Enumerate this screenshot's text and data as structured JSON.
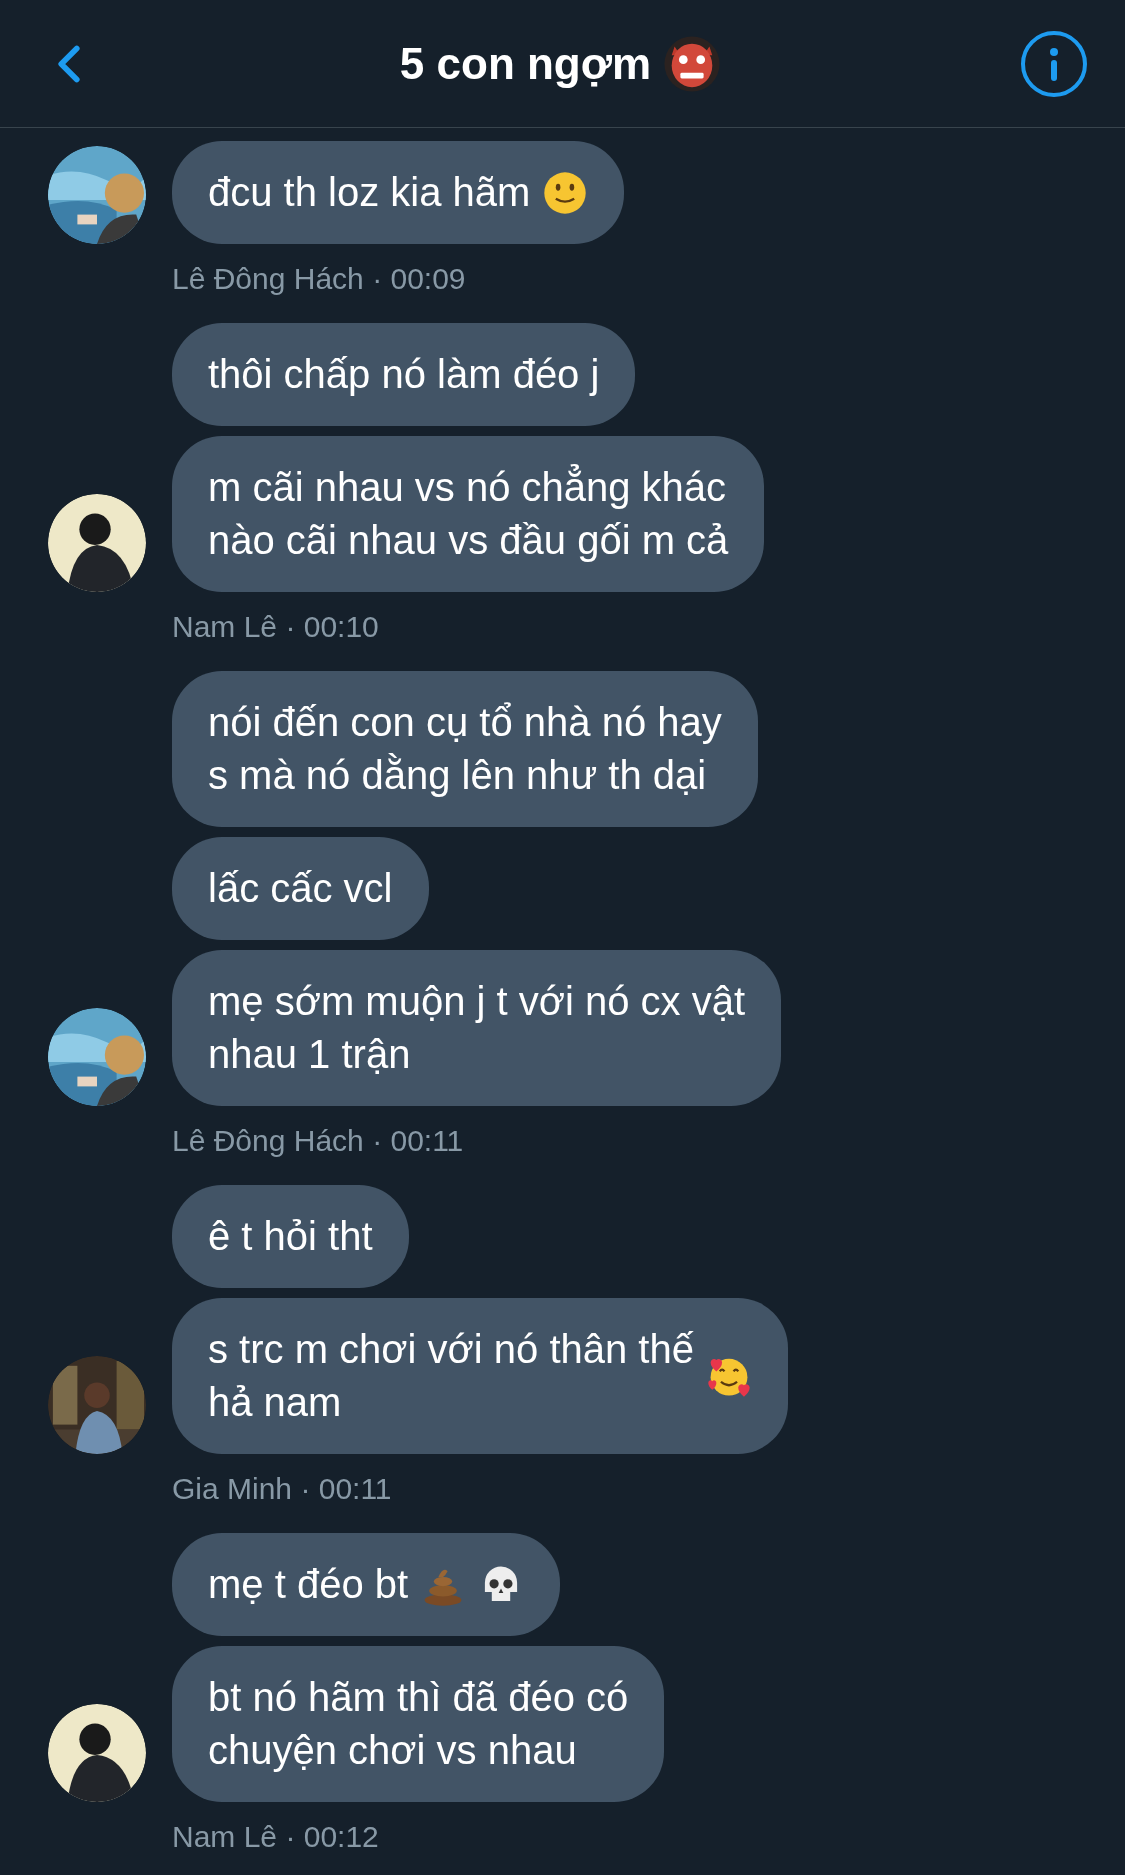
{
  "header": {
    "title": "5 con ngợm",
    "title_icons": [
      {
        "kind": "ogre"
      }
    ]
  },
  "groups": [
    {
      "avatar": {
        "kind": "picture"
      },
      "meta": "Lê Đông Hách · 00:09",
      "messages": [
        {
          "lines": [
            "đcu th loz kia hãm"
          ],
          "icons": [
            {
              "kind": "smile"
            }
          ]
        }
      ]
    },
    {
      "avatar": {
        "kind": "picture"
      },
      "meta": "Nam Lê · 00:10",
      "messages": [
        {
          "lines": [
            "thôi chấp nó làm đéo j"
          ]
        },
        {
          "lines": [
            "m cãi nhau vs nó chẳng khác",
            "nào cãi nhau vs đầu gối m cả"
          ]
        }
      ]
    },
    {
      "avatar": {
        "kind": "picture"
      },
      "meta": "Lê Đông Hách · 00:11",
      "messages": [
        {
          "lines": [
            "nói đến con cụ tổ nhà nó hay",
            "s mà nó dằng lên như th dại"
          ]
        },
        {
          "lines": [
            "lấc cấc vcl"
          ]
        },
        {
          "lines": [
            "mẹ sớm muộn j t với nó cx vật",
            "nhau 1 trận"
          ]
        }
      ]
    },
    {
      "avatar": {
        "kind": "picture"
      },
      "meta": "Gia Minh · 00:11",
      "messages": [
        {
          "lines": [
            "ê t hỏi tht"
          ]
        },
        {
          "lines": [
            "s trc m chơi với nó thân thế",
            "hả nam"
          ],
          "icons": [
            {
              "kind": "hearts"
            }
          ]
        }
      ]
    },
    {
      "avatar": {
        "kind": "picture"
      },
      "meta": "Nam Lê · 00:12",
      "messages": [
        {
          "lines": [
            "mẹ t đéo bt"
          ],
          "icons": [
            {
              "kind": "poop"
            },
            {
              "kind": "skull"
            }
          ]
        },
        {
          "lines": [
            "bt nó hãm thì đã đéo có",
            "chuyện chơi vs nhau"
          ]
        }
      ]
    }
  ]
}
